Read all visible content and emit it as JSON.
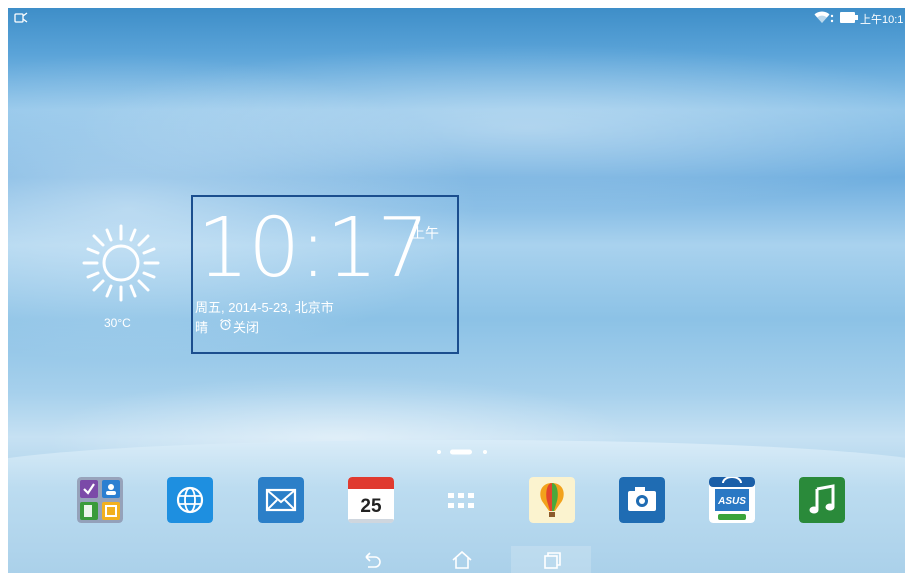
{
  "statusbar": {
    "time": "上午10:1",
    "icons": [
      "notification-icon",
      "wifi-icon",
      "battery-icon"
    ]
  },
  "weather": {
    "icon": "sun-icon",
    "temperature": "30°C"
  },
  "clock": {
    "time": "10:17",
    "ampm": "上午",
    "date_location": "周五, 2014-5-23, 北京市",
    "condition": "晴",
    "alarm": "关闭"
  },
  "page_indicator": {
    "pages": 3,
    "current": 2
  },
  "dock": {
    "apps": [
      {
        "name": "folder-app-icon"
      },
      {
        "name": "browser-app-icon"
      },
      {
        "name": "email-app-icon"
      },
      {
        "name": "calendar-app-icon",
        "text": "25"
      },
      {
        "name": "all-apps-icon"
      },
      {
        "name": "gallery-app-icon"
      },
      {
        "name": "camera-app-icon"
      },
      {
        "name": "asus-store-app-icon",
        "text": "ASUS"
      },
      {
        "name": "music-app-icon"
      }
    ]
  },
  "navbar": {
    "buttons": [
      "back-icon",
      "home-icon",
      "recent-apps-icon"
    ]
  },
  "colors": {
    "clock_frame": "#1b4e8e",
    "browser": "#1e8fe0",
    "email": "#2b7fc8",
    "camera": "#1f6cb3",
    "music": "#2a8a3a"
  }
}
